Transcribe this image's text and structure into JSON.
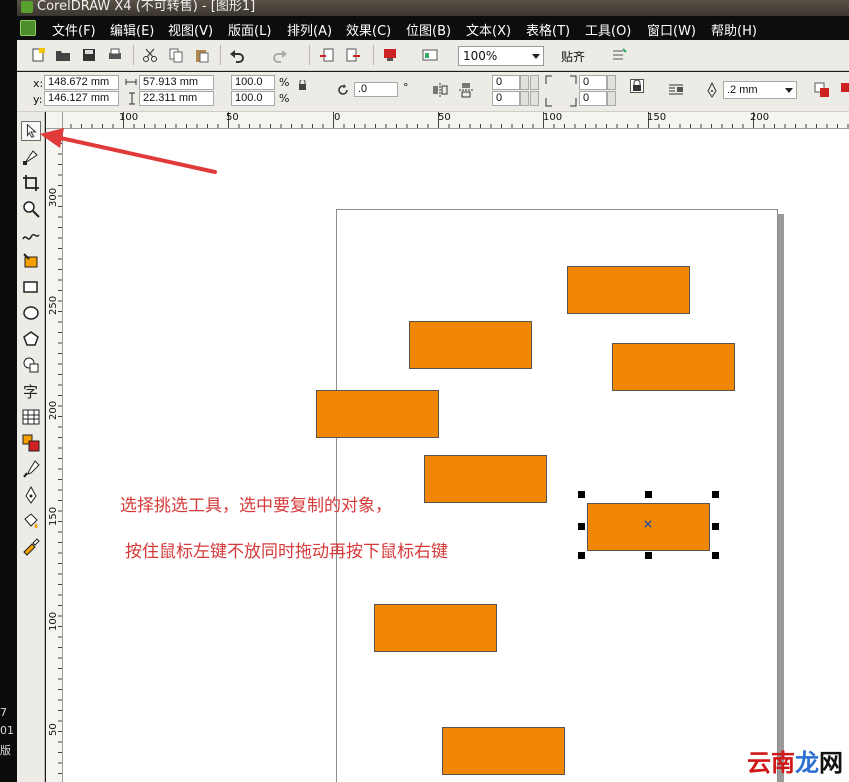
{
  "window": {
    "title": "CorelDRAW X4 (不可转售) - [图形1]"
  },
  "desktop": {
    "line1": "7",
    "line2": "01",
    "line3": "版"
  },
  "menu": [
    "文件(F)",
    "编辑(E)",
    "视图(V)",
    "版面(L)",
    "排列(A)",
    "效果(C)",
    "位图(B)",
    "文本(X)",
    "表格(T)",
    "工具(O)",
    "窗口(W)",
    "帮助(H)"
  ],
  "standard_toolbar": {
    "zoom": "100%",
    "snap": "贴齐"
  },
  "property_bar": {
    "x_label": "x:",
    "x": "148.672 mm",
    "y_label": "y:",
    "y": "146.127 mm",
    "width": "57.913 mm",
    "height": "22.311 mm",
    "scale_x": "100.0",
    "scale_y": "100.0",
    "percent": "%",
    "rotation": ".0",
    "degree": "°",
    "corner_tl": "0",
    "corner_bl": "0",
    "corner_tr": "0",
    "corner_br": "0",
    "outline": ".2 mm"
  },
  "ruler_top": [
    "100",
    "50",
    "0",
    "50",
    "100",
    "150",
    "200"
  ],
  "ruler_left": [
    "300",
    "250",
    "200",
    "150",
    "100",
    "50"
  ],
  "annotation": {
    "line1": "选择挑选工具，选中要复制的对象，",
    "line2": "按住鼠标左键不放同时拖动再按下鼠标右键"
  },
  "watermark": {
    "part1": "云南",
    "part2": "龙",
    "part3": "网"
  },
  "colors": {
    "object_fill": "#f28705",
    "annotation": "#d63a3a",
    "arrow": "#e03a3a"
  }
}
